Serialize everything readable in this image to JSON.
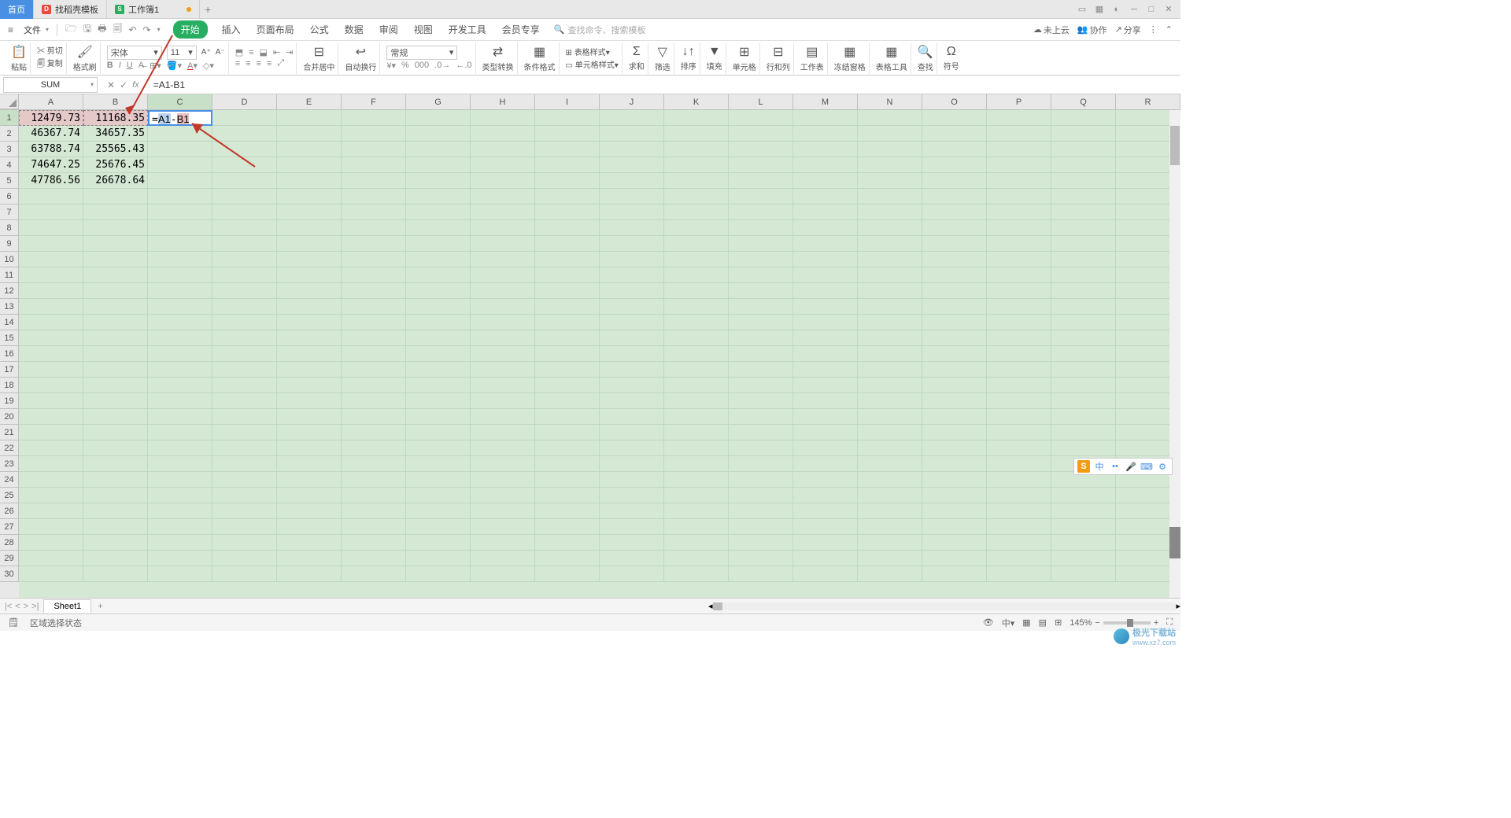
{
  "tabs": {
    "home": "首页",
    "template": "找稻壳模板",
    "workbook": "工作簿1"
  },
  "menu": {
    "file": "文件",
    "tabs": [
      "开始",
      "插入",
      "页面布局",
      "公式",
      "数据",
      "审阅",
      "视图",
      "开发工具",
      "会员专享"
    ],
    "search_placeholder": "查找命令、搜索模板",
    "cloud": "未上云",
    "collab": "协作",
    "share": "分享"
  },
  "ribbon": {
    "paste": "粘贴",
    "cut": "剪切",
    "copy": "复制",
    "brush": "格式刷",
    "font_name": "宋体",
    "font_size": "11",
    "merge": "合并居中",
    "wrap": "自动换行",
    "general": "常规",
    "type_conv": "类型转换",
    "cond_fmt": "条件格式",
    "table_fmt": "表格样式",
    "cell_fmt": "单元格样式",
    "sum": "求和",
    "filter": "筛选",
    "sort": "排序",
    "fill": "填充",
    "cells": "单元格",
    "rowcol": "行和列",
    "sheet": "工作表",
    "freeze": "冻结窗格",
    "table_tool": "表格工具",
    "find": "查找",
    "symbol": "符号"
  },
  "formula": {
    "name_box": "SUM",
    "content": "=A1-B1"
  },
  "columns": [
    "A",
    "B",
    "C",
    "D",
    "E",
    "F",
    "G",
    "H",
    "I",
    "J",
    "K",
    "L",
    "M",
    "N",
    "O",
    "P",
    "Q",
    "R"
  ],
  "row_count": 30,
  "sheet_data": {
    "A1": "12479.73",
    "B1": "11168.35",
    "A2": "46367.74",
    "B2": "34657.35",
    "A3": "63788.74",
    "B3": "25565.43",
    "A4": "74647.25",
    "B4": "25676.45",
    "A5": "47786.56",
    "B5": "26678.64"
  },
  "editing_cell": {
    "ref": "C1",
    "display": "=A1-B1",
    "prefix": "=",
    "ref_a": "A1",
    "op": "-",
    "ref_b": "B1"
  },
  "sheet_tab": "Sheet1",
  "status": {
    "mode": "区域选择状态",
    "zoom": "145%"
  },
  "ime": {
    "lang": "中"
  },
  "watermark": {
    "brand": "极光下载站",
    "url": "www.xz7.com"
  }
}
